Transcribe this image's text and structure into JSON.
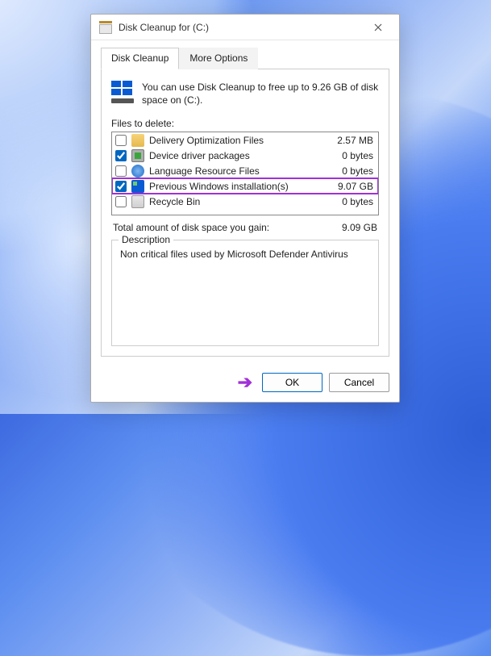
{
  "window": {
    "title": "Disk Cleanup for  (C:)"
  },
  "tabs": {
    "disk_cleanup": "Disk Cleanup",
    "more_options": "More Options"
  },
  "intro": "You can use Disk Cleanup to free up to 9.26 GB of disk space on  (C:).",
  "files_label": "Files to delete:",
  "files": [
    {
      "name": "Delivery Optimization Files",
      "size": "2.57 MB",
      "checked": false,
      "icon": "ic-folder"
    },
    {
      "name": "Device driver packages",
      "size": "0 bytes",
      "checked": true,
      "icon": "ic-package"
    },
    {
      "name": "Language Resource Files",
      "size": "0 bytes",
      "checked": false,
      "icon": "ic-globe"
    },
    {
      "name": "Previous Windows installation(s)",
      "size": "9.07 GB",
      "checked": true,
      "icon": "ic-win",
      "highlight": true
    },
    {
      "name": "Recycle Bin",
      "size": "0 bytes",
      "checked": false,
      "icon": "ic-bin"
    }
  ],
  "total": {
    "label": "Total amount of disk space you gain:",
    "value": "9.09 GB"
  },
  "description": {
    "legend": "Description",
    "text": "Non critical files used by Microsoft Defender Antivirus"
  },
  "buttons": {
    "ok": "OK",
    "cancel": "Cancel"
  },
  "annotations": {
    "highlight_color": "#a030d8"
  }
}
